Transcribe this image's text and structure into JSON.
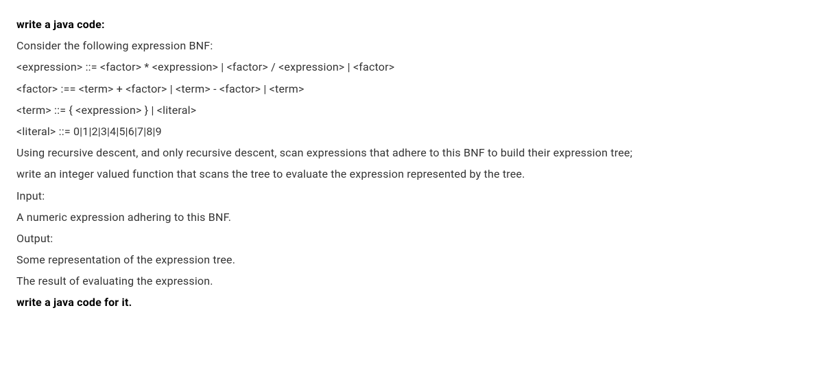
{
  "lines": {
    "l1": "write a java code:",
    "l2": "Consider the following expression BNF:",
    "l3": "<expression> ::= <factor> * <expression> | <factor> / <expression> | <factor>",
    "l4": "<factor> :== <term> + <factor> | <term> - <factor> | <term>",
    "l5": "<term> ::= { <expression> } | <literal>",
    "l6": "<literal> ::= 0|1|2|3|4|5|6|7|8|9",
    "l7": "Using recursive descent, and only recursive descent, scan expressions that adhere to this BNF to build their expression tree;",
    "l8": "write an integer valued function that scans the tree to evaluate the expression represented by the tree.",
    "l9": "Input:",
    "l10": "A numeric expression adhering to this BNF.",
    "l11": "Output:",
    "l12": "Some representation of the expression tree.",
    "l13": "The result of evaluating the expression.",
    "l14": "write a java code for it."
  }
}
